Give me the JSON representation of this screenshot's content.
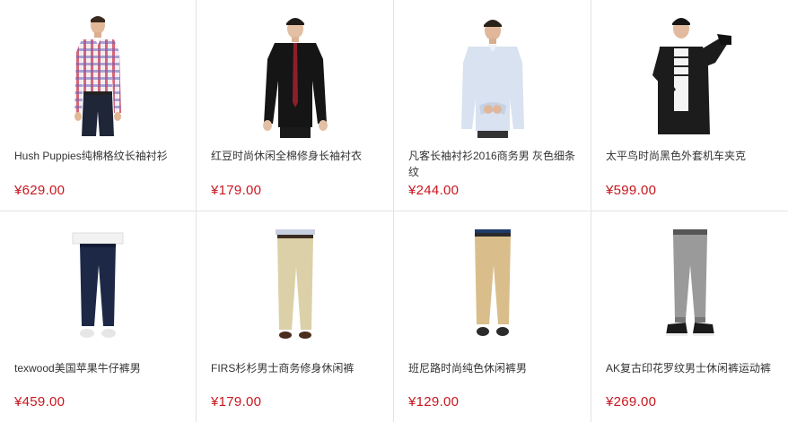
{
  "products": [
    {
      "name": "Hush Puppies纯棉格纹长袖衬衫",
      "price": "¥629.00",
      "icon": "plaid-shirt-model"
    },
    {
      "name": "红豆时尚休闲全棉修身长袖衬衣",
      "price": "¥179.00",
      "icon": "black-shirt-model"
    },
    {
      "name": "凡客长袖衬衫2016商务男 灰色细条纹",
      "price": "¥244.00",
      "icon": "light-blue-shirt-model"
    },
    {
      "name": "太平鸟时尚黑色外套机车夹克",
      "price": "¥599.00",
      "icon": "leather-jacket-model"
    },
    {
      "name": "texwood美国苹果牛仔裤男",
      "price": "¥459.00",
      "icon": "dark-jeans"
    },
    {
      "name": "FIRS杉杉男士商务修身休闲裤",
      "price": "¥179.00",
      "icon": "khaki-trousers"
    },
    {
      "name": "班尼路时尚纯色休闲裤男",
      "price": "¥129.00",
      "icon": "khaki-chinos"
    },
    {
      "name": "AK复古印花罗纹男士休闲裤运动裤",
      "price": "¥269.00",
      "icon": "grey-jogger-pants"
    }
  ],
  "colors": {
    "price": "#c8161e",
    "divider": "#e3e3e3"
  }
}
